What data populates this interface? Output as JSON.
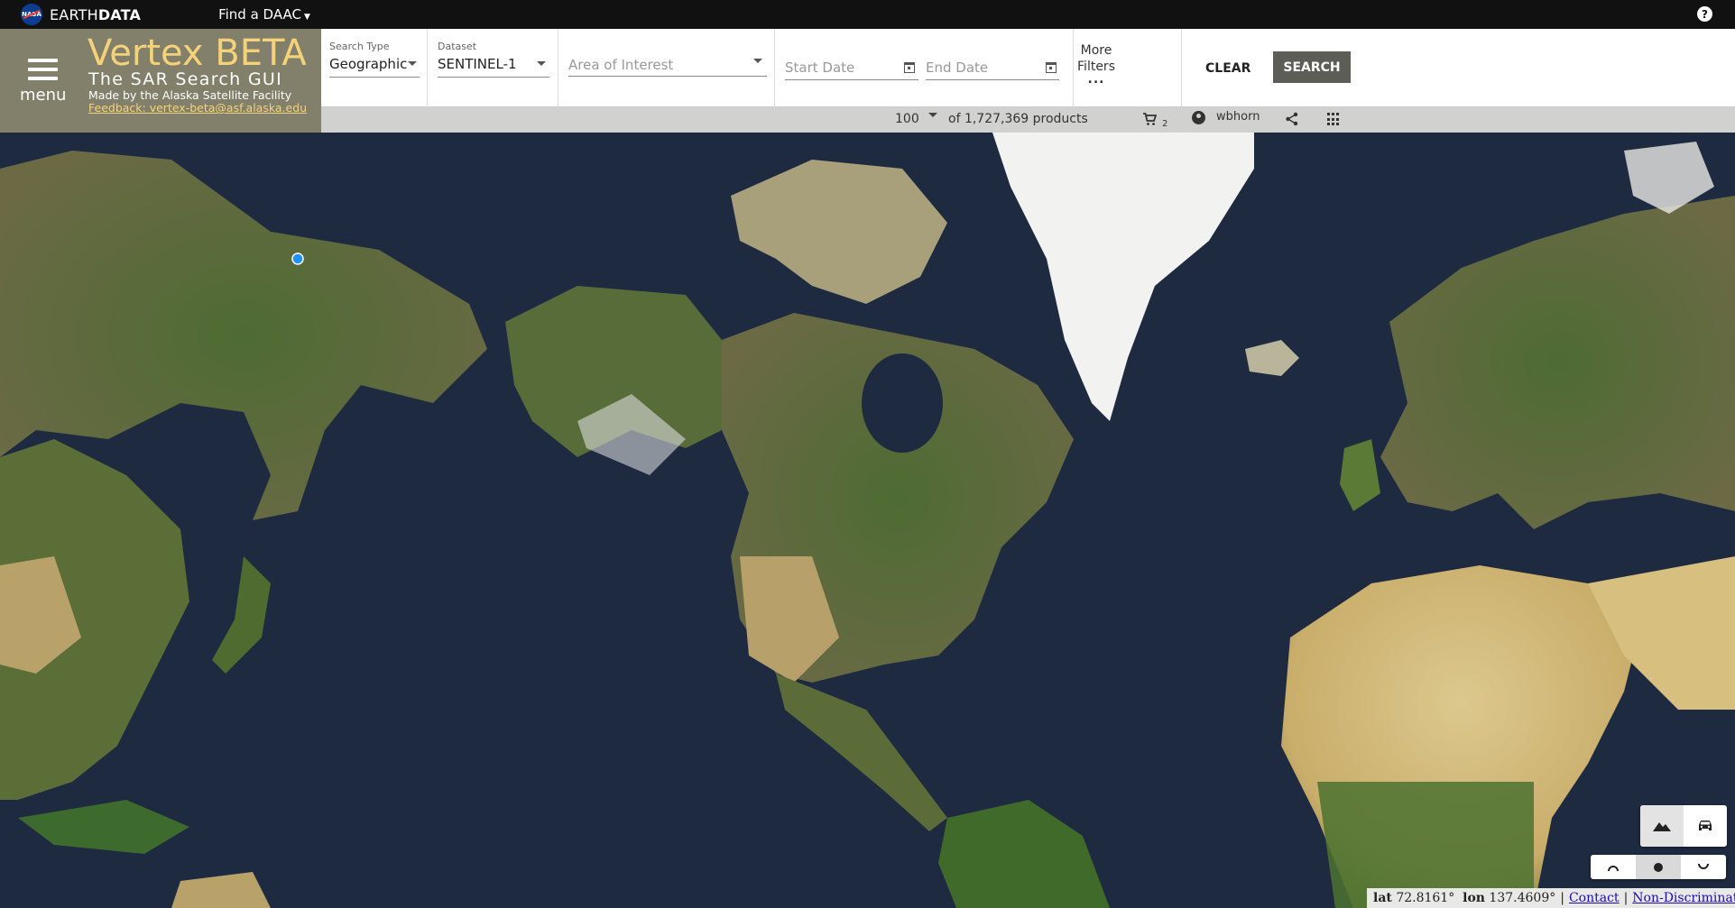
{
  "earthdata": {
    "logo": "NASA",
    "brand_plain": "EARTH",
    "brand_bold": "DATA",
    "find_daac": "Find a DAAC",
    "help": "?"
  },
  "header": {
    "menu_label": "menu",
    "title": "Vertex BETA",
    "subtitle": "The SAR Search GUI",
    "made_by": "Made by the Alaska Satellite Facility",
    "feedback": "Feedback: vertex-beta@asf.alaska.edu"
  },
  "filters": {
    "search_type_label": "Search Type",
    "search_type_value": "Geographic",
    "dataset_label": "Dataset",
    "dataset_value": "SENTINEL-1",
    "aoi_placeholder": "Area of Interest",
    "start_date_placeholder": "Start Date",
    "end_date_placeholder": "End Date",
    "more_filters_line1": "More",
    "more_filters_line2": "Filters",
    "more_filters_dots": "...",
    "clear": "CLEAR",
    "search": "SEARCH"
  },
  "status": {
    "max_results": "100",
    "products": "of 1,727,369 products",
    "cart_count": "2",
    "username": "wbhorn"
  },
  "map": {
    "marker_color": "#1e90ff",
    "base_layers": [
      "mountain-icon",
      "car-icon"
    ],
    "projections": [
      "arctic-projection-icon",
      "equatorial-projection-icon",
      "antarctic-projection-icon"
    ]
  },
  "footer": {
    "lat_label": "lat",
    "lat_value": "72.8161°",
    "lon_label": "lon",
    "lon_value": "137.4609°",
    "contact": "Contact",
    "non_discrimination": "Non-Discrimination"
  },
  "colors": {
    "brand_panel": "#82806a",
    "title": "#f4d27a",
    "search_button": "#5d5d58",
    "ocean": "#1e2a3f"
  }
}
